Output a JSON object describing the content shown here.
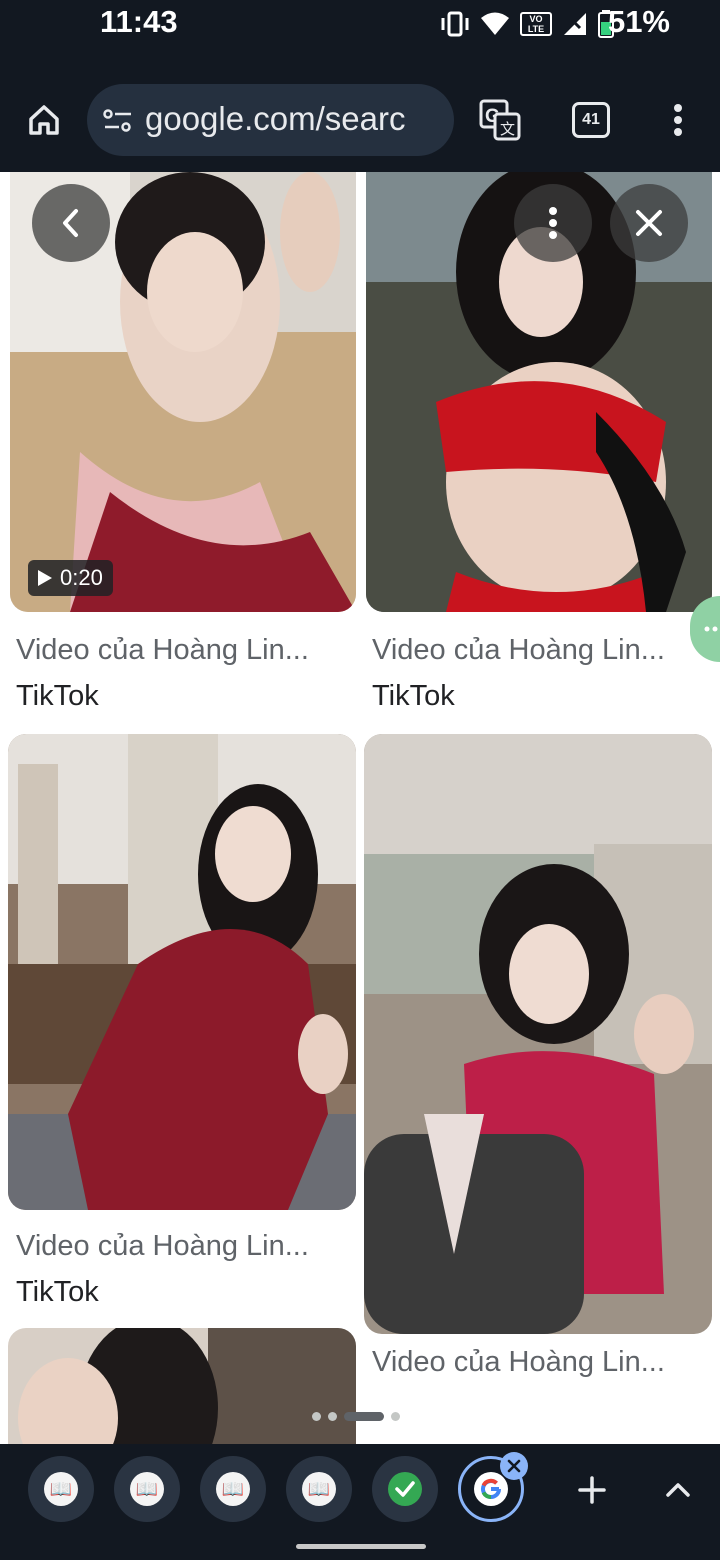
{
  "status_bar": {
    "time": "11:43",
    "battery_percent": "51%",
    "network_label": "VO LTE"
  },
  "toolbar": {
    "url": "google.com/searc",
    "tab_count": "41",
    "icons": [
      "home-icon",
      "site-settings-icon",
      "translate-icon",
      "tab-switcher-icon",
      "more-vert-icon"
    ]
  },
  "overlay": {
    "icons": [
      "back-chevron-icon",
      "more-vert-icon",
      "close-icon"
    ]
  },
  "results": [
    {
      "caption": "Video của Hoàng Lin...",
      "source": "TikTok",
      "duration": "0:20"
    },
    {
      "caption": "Video của Hoàng Lin...",
      "source": "TikTok"
    },
    {
      "caption": "Video của Hoàng Lin...",
      "source": "TikTok"
    },
    {
      "caption": "Video của Hoàng Lin..."
    }
  ],
  "pager": {
    "count": 4,
    "active_index": 2
  },
  "tab_strip": {
    "tabs": [
      "book-favicon",
      "book-favicon",
      "book-favicon",
      "book-favicon",
      "checkmark-favicon",
      "google-favicon"
    ],
    "active_index": 5,
    "icons": [
      "new-tab-plus-icon",
      "expand-chevron-up-icon"
    ]
  },
  "colors": {
    "chrome_dark": "#121821",
    "omnibox": "#25303f",
    "caption_text": "#5f6368",
    "active_tab_ring": "#8ab4f8"
  }
}
